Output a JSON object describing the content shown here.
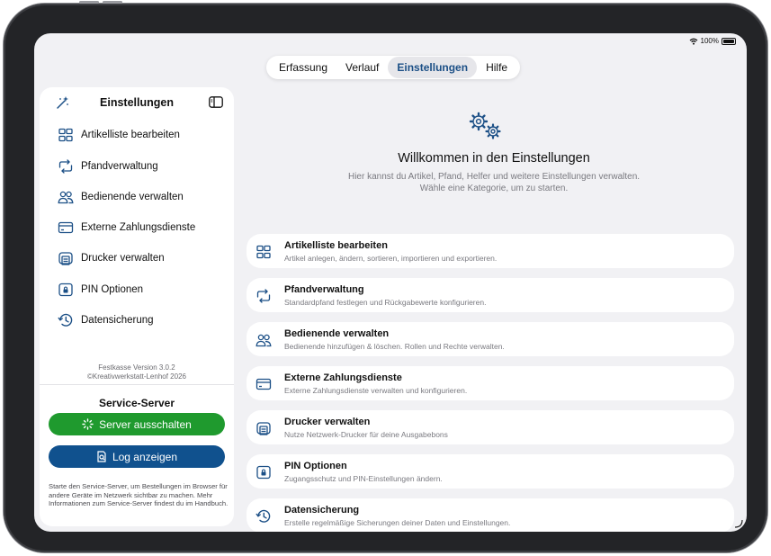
{
  "status": {
    "battery": "100%"
  },
  "tabs": [
    {
      "label": "Erfassung",
      "active": false
    },
    {
      "label": "Verlauf",
      "active": false
    },
    {
      "label": "Einstellungen",
      "active": true
    },
    {
      "label": "Hilfe",
      "active": false
    }
  ],
  "sidebar": {
    "title": "Einstellungen",
    "items": [
      {
        "label": "Artikelliste bearbeiten",
        "icon": "grid-icon"
      },
      {
        "label": "Pfandverwaltung",
        "icon": "arrows-cycle-icon"
      },
      {
        "label": "Bedienende verwalten",
        "icon": "people-icon"
      },
      {
        "label": "Externe Zahlungsdienste",
        "icon": "credit-card-icon"
      },
      {
        "label": "Drucker verwalten",
        "icon": "printer-icon"
      },
      {
        "label": "PIN Optionen",
        "icon": "lock-icon"
      },
      {
        "label": "Datensicherung",
        "icon": "backup-clock-icon"
      }
    ],
    "version_line1": "Festkasse Version 3.0.2",
    "version_line2": "©Kreativwerkstatt-Lenhof 2026",
    "server_title": "Service-Server",
    "server_button": "Server ausschalten",
    "log_button": "Log anzeigen",
    "note": "Starte den Service-Server, um Bestellungen im Browser für andere Geräte im Netzwerk sichtbar zu machen. Mehr Informationen zum Service-Server findest du im Handbuch."
  },
  "main": {
    "welcome": "Willkommen in den Einstellungen",
    "sub_line1": "Hier kannst du Artikel, Pfand, Helfer und weitere Einstellungen verwalten.",
    "sub_line2": "Wähle eine Kategorie, um zu starten.",
    "cards": [
      {
        "title": "Artikelliste bearbeiten",
        "desc": "Artikel anlegen, ändern, sortieren, importieren und exportieren."
      },
      {
        "title": "Pfandverwaltung",
        "desc": "Standardpfand festlegen und Rückgabewerte konfigurieren."
      },
      {
        "title": "Bedienende verwalten",
        "desc": "Bedienende hinzufügen & löschen. Rollen und Rechte verwalten."
      },
      {
        "title": "Externe Zahlungsdienste",
        "desc": "Externe Zahlungsdienste verwalten und konfigurieren."
      },
      {
        "title": "Drucker verwalten",
        "desc": "Nutze Netzwerk-Drucker für deine Ausgabebons"
      },
      {
        "title": "PIN Optionen",
        "desc": "Zugangsschutz und PIN-Einstellungen ändern."
      },
      {
        "title": "Datensicherung",
        "desc": "Erstelle regelmäßige Sicherungen deiner Daten und Einstellungen."
      }
    ]
  },
  "colors": {
    "accent": "#10518e",
    "green": "#1f9a2e",
    "active_tab_text": "#1b4f86"
  }
}
